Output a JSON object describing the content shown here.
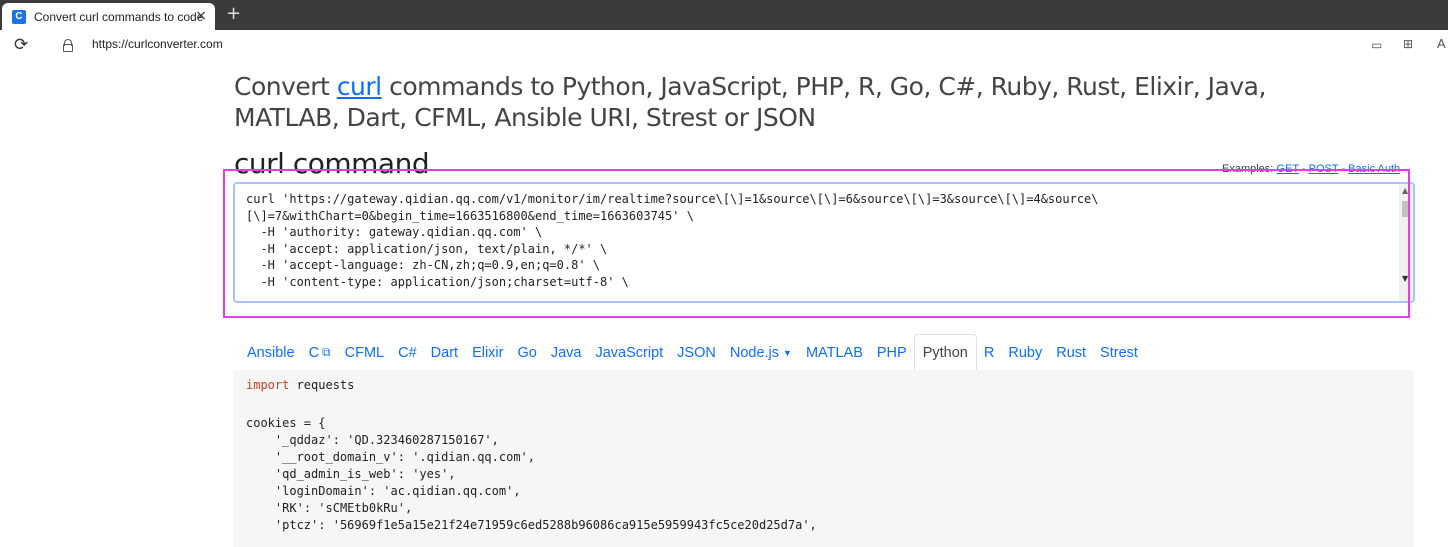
{
  "browser": {
    "tab_title": "Convert curl commands to code",
    "tab_icon": "C",
    "close_glyph": "×",
    "newtab_glyph": "+",
    "url": "https://curlconverter.com",
    "partial_label": "A"
  },
  "header": {
    "prefix": "Convert ",
    "link": "curl",
    "suffix": " commands to Python, JavaScript, PHP, R, Go, C#, Ruby, Rust, Elixir, Java, MATLAB, Dart, CFML, Ansible URI, Strest or JSON"
  },
  "curl_section": {
    "title": "curl command",
    "examples_label": "Examples: ",
    "examples": [
      "GET",
      "POST",
      "Basic Auth"
    ],
    "separator": " - ",
    "lines": [
      "curl 'https://gateway.qidian.qq.com/v1/monitor/im/realtime?source\\[\\]=1&source\\[\\]=6&source\\[\\]=3&source\\[\\]=4&source\\",
      "[\\]=7&withChart=0&begin_time=1663516800&end_time=1663603745' \\",
      "  -H 'authority: gateway.qidian.qq.com' \\",
      "  -H 'accept: application/json, text/plain, */*' \\",
      "  -H 'accept-language: zh-CN,zh;q=0.9,en;q=0.8' \\",
      "  -H 'content-type: application/json;charset=utf-8' \\"
    ]
  },
  "languages": {
    "items": [
      "Ansible",
      "C",
      "CFML",
      "C#",
      "Dart",
      "Elixir",
      "Go",
      "Java",
      "JavaScript",
      "JSON",
      "Node.js",
      "MATLAB",
      "PHP",
      "Python",
      "R",
      "Ruby",
      "Rust",
      "Strest"
    ],
    "active": "Python"
  },
  "code": {
    "import_kw": "import",
    "import_mod": " requests",
    "cookies_open": "cookies = {",
    "cookies": [
      {
        "key": "'_qddaz'",
        "value": "'QD.323460287150167',"
      },
      {
        "key": "'__root_domain_v'",
        "value": "'.qidian.qq.com',"
      },
      {
        "key": "'qd_admin_is_web'",
        "value": "'yes',"
      },
      {
        "key": "'loginDomain'",
        "value": "'ac.qidian.qq.com',"
      },
      {
        "key": "'RK'",
        "value": "'sCMEtb0kRu',"
      },
      {
        "key": "'ptcz'",
        "value": "'56969f1e5a15e21f24e71959c6ed5288b96086ca915e5959943fc5ce20d25d7a',"
      }
    ]
  }
}
